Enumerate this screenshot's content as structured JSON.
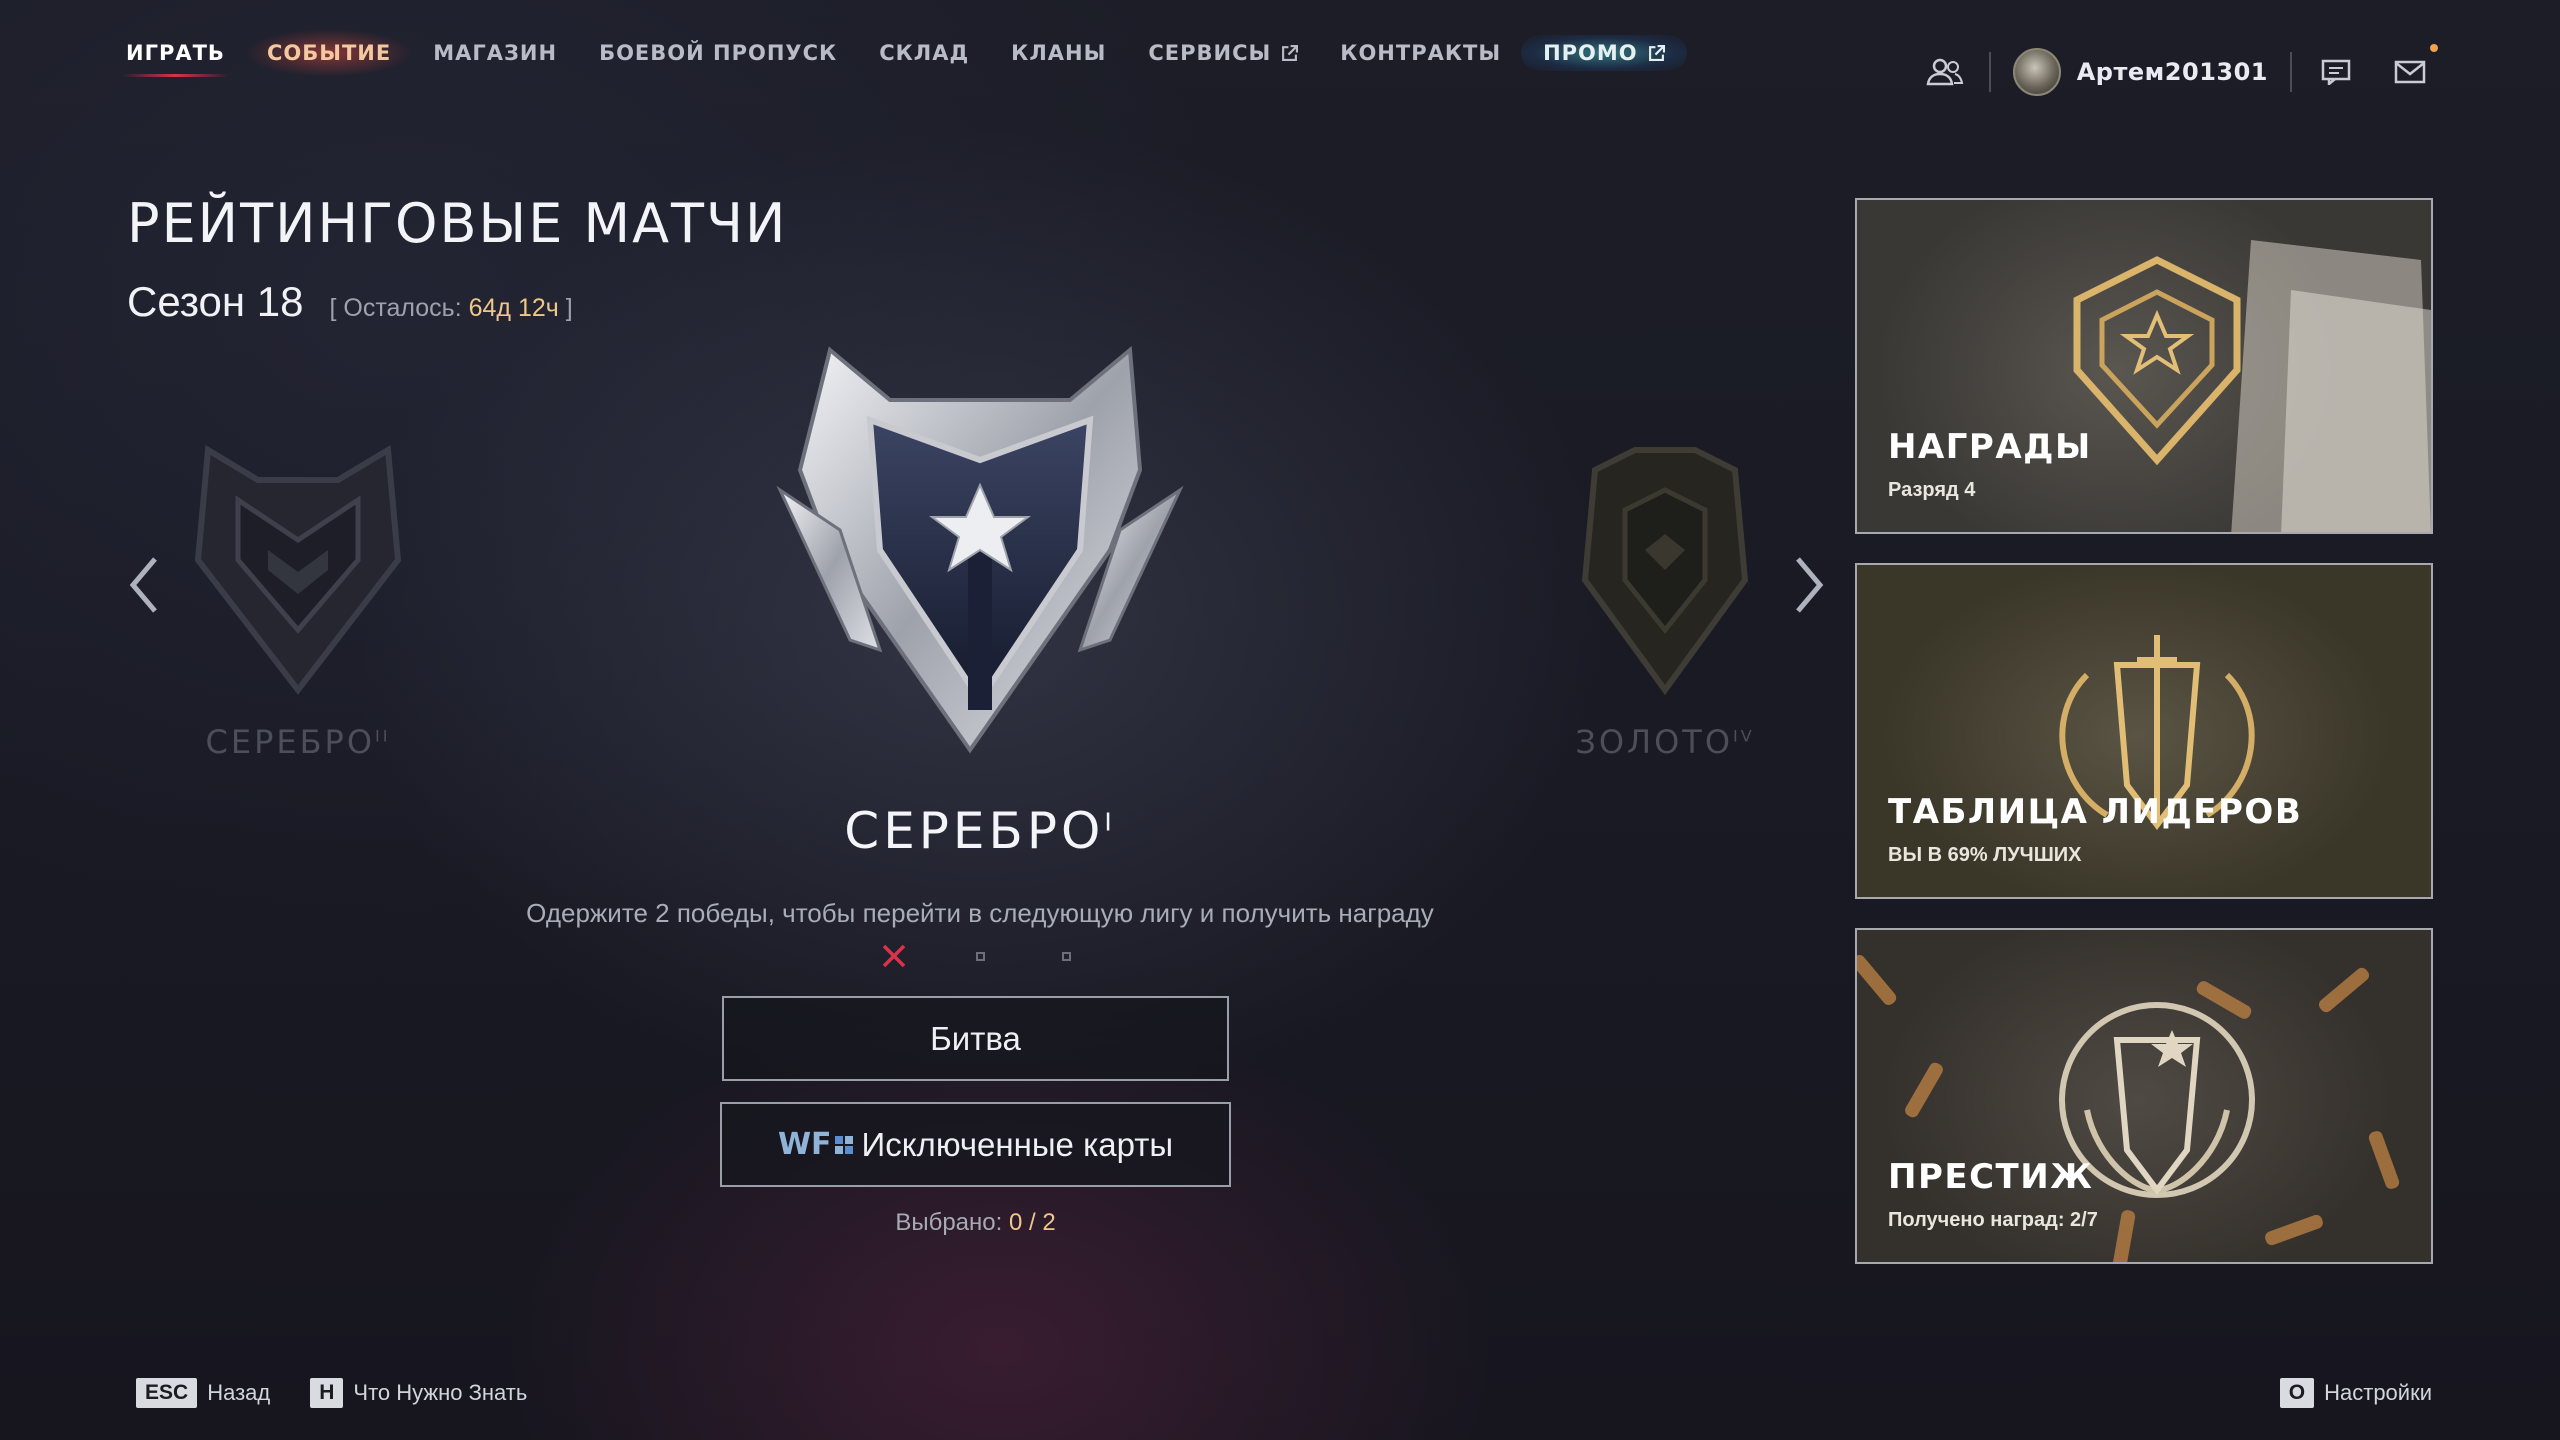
{
  "nav": {
    "items": [
      {
        "label": "ИГРАТЬ"
      },
      {
        "label": "СОБЫТИЕ"
      },
      {
        "label": "МАГАЗИН"
      },
      {
        "label": "БОЕВОЙ ПРОПУСК"
      },
      {
        "label": "СКЛАД"
      },
      {
        "label": "КЛАНЫ"
      },
      {
        "label": "СЕРВИСЫ"
      },
      {
        "label": "КОНТРАКТЫ"
      },
      {
        "label": "ПРОМО"
      }
    ]
  },
  "user": {
    "name": "Артем201301"
  },
  "page": {
    "title": "РЕЙТИНГОВЫЕ МАТЧИ",
    "season": "Сезон 18",
    "remaining_prefix": "[ Осталось: ",
    "remaining_value": "64д 12ч",
    "remaining_suffix": " ]"
  },
  "ranks": {
    "prev": {
      "name": "СЕРЕБРО",
      "tier": "II"
    },
    "current": {
      "name": "СЕРЕБРО",
      "tier": "I"
    },
    "next": {
      "name": "ЗОЛОТО",
      "tier": "IV"
    }
  },
  "goal_text": "Одержите 2 победы, чтобы перейти в следующую лигу и получить награду",
  "progress": {
    "lost": 1,
    "total": 3
  },
  "buttons": {
    "battle": "Битва",
    "excluded_logo": "WF",
    "excluded_maps": "Исключенные карты"
  },
  "selected": {
    "label": "Выбрано: ",
    "value": "0 / 2"
  },
  "cards": [
    {
      "title": "НАГРАДЫ",
      "subtitle": "Разряд 4"
    },
    {
      "title": "ТАБЛИЦА ЛИДЕРОВ",
      "subtitle": "ВЫ В 69% ЛУЧШИХ"
    },
    {
      "title": "ПРЕСТИЖ",
      "subtitle": "Получено наград: 2/7"
    }
  ],
  "footer": {
    "esc_key": "ESC",
    "esc_label": "Назад",
    "h_key": "H",
    "h_label": "Что Нужно Знать",
    "o_key": "O",
    "o_label": "Настройки"
  },
  "colors": {
    "accent_gold": "#f0c78a",
    "active_underline": "#d8334b",
    "promo_glow": "#3c96a0",
    "loss_mark": "#d8334b"
  }
}
